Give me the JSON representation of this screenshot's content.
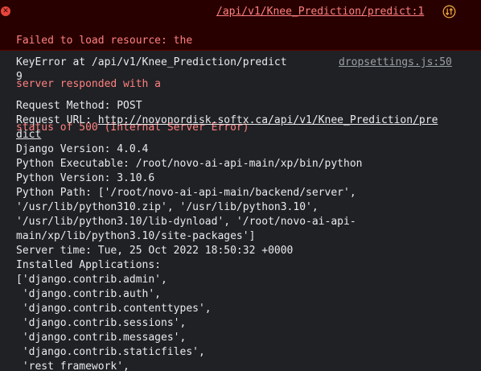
{
  "error_message": {
    "text_lines": [
      "Failed to load resource: the",
      "server responded with a",
      "status of 500 (Internal Server Error)"
    ],
    "source": "/api/v1/Knee_Prediction/predict:1",
    "icon": "error-x-icon",
    "network_icon": "network-request-icon",
    "colors": {
      "background": "#290000",
      "text": "#ff8080",
      "icon": "#e8453c"
    }
  },
  "log_message": {
    "source": "dropsettings.js:50",
    "title_lines": [
      "KeyError at /api/v1/Knee_Prediction/predict",
      "9"
    ],
    "request_method": "Request Method: POST",
    "request_url_label": "Request URL: ",
    "request_url_lines": [
      "http://novonordisk.softx.ca/api/v1/Knee_Prediction/pre",
      "dict"
    ],
    "django_version": "Django Version: 4.0.4",
    "python_executable": "Python Executable: /root/novo-ai-api-main/xp/bin/python",
    "python_version": "Python Version: 3.10.6",
    "python_path_lines": [
      "Python Path: ['/root/novo-ai-api-main/backend/server',",
      "'/usr/lib/python310.zip', '/usr/lib/python3.10',",
      "'/usr/lib/python3.10/lib-dynload', '/root/novo-ai-api-",
      "main/xp/lib/python3.10/site-packages']"
    ],
    "server_time": "Server time: Tue, 25 Oct 2022 18:50:32 +0000",
    "installed_apps_label": "Installed Applications:",
    "installed_apps": [
      "['django.contrib.admin',",
      " 'django.contrib.auth',",
      " 'django.contrib.contenttypes',",
      " 'django.contrib.sessions',",
      " 'django.contrib.messages',",
      " 'django.contrib.staticfiles',",
      " 'rest_framework',"
    ]
  }
}
